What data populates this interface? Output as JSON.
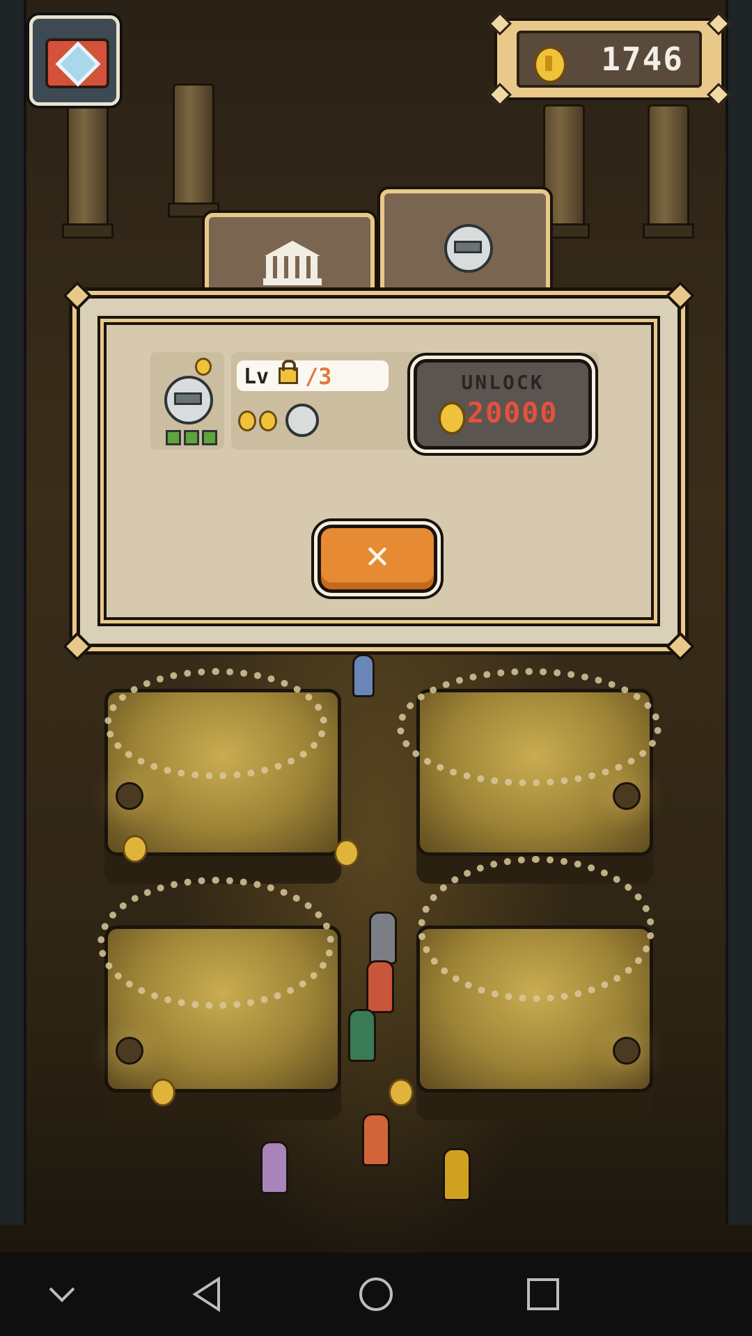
{
  "hud": {
    "coins": "1746",
    "camera_icon": "camera-icon",
    "coin_icon": "coin-icon"
  },
  "tabs": [
    {
      "icon": "museum-icon",
      "selected": false
    },
    {
      "icon": "robot-icon",
      "selected": true
    }
  ],
  "dialog": {
    "item": {
      "icon": "robot-icon",
      "level_prefix": "Lv",
      "level_max": "/3",
      "locked": true,
      "income_icons": [
        "coin-icon",
        "coin-icon",
        "robot-icon"
      ]
    },
    "unlock_button": {
      "label": "UNLOCK",
      "price": "20000"
    },
    "close_button": {
      "label": "✕"
    }
  },
  "navbar": {
    "icons": [
      "chevron-down-icon",
      "back-icon",
      "home-icon",
      "recent-apps-icon"
    ]
  },
  "colors": {
    "accent_orange": "#e68a34",
    "price_red": "#e8503a",
    "frame_gold": "#e9c98a",
    "panel_tan": "#d6c9ae"
  }
}
